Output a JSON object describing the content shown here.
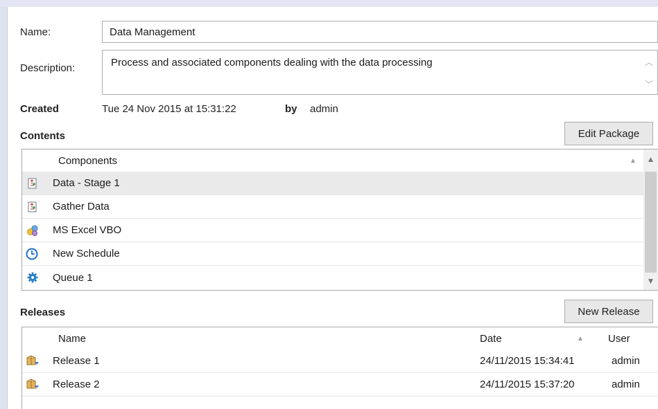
{
  "form": {
    "name_label": "Name:",
    "name_value": "Data Management",
    "description_label": "Description:",
    "description_value": "Process and associated components dealing with the data processing",
    "created_label": "Created",
    "created_value": "Tue 24 Nov 2015 at 15:31:22",
    "by_label": "by",
    "by_value": "admin"
  },
  "contents": {
    "title": "Contents",
    "edit_button": "Edit Package",
    "column_header": "Components",
    "items": [
      {
        "label": "Data - Stage 1",
        "icon": "process-icon",
        "selected": true
      },
      {
        "label": "Gather Data",
        "icon": "process-icon",
        "selected": false
      },
      {
        "label": "MS Excel VBO",
        "icon": "business-object-icon",
        "selected": false
      },
      {
        "label": "New Schedule",
        "icon": "clock-icon",
        "selected": false
      },
      {
        "label": "Queue 1",
        "icon": "gear-icon",
        "selected": false
      }
    ]
  },
  "releases": {
    "title": "Releases",
    "new_button": "New Release",
    "columns": {
      "name": "Name",
      "date": "Date",
      "user": "User"
    },
    "rows": [
      {
        "name": "Release 1",
        "date": "24/11/2015 15:34:41",
        "user": "admin",
        "icon": "package-icon"
      },
      {
        "name": "Release 2",
        "date": "24/11/2015 15:37:20",
        "user": "admin",
        "icon": "package-icon"
      }
    ]
  },
  "colors": {
    "selected_row": "#eaeaea",
    "clock_blue": "#1e6fd0",
    "gear_blue": "#2a7fc9",
    "package_tan": "#c99a3c"
  }
}
